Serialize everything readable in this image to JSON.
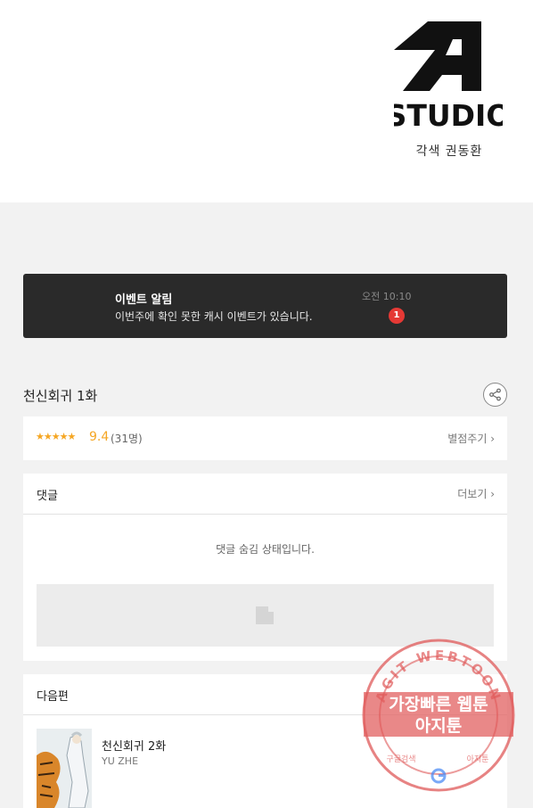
{
  "hero": {
    "logo_text": "STUDIO",
    "credit": "각색 권동환"
  },
  "banner": {
    "title": "이벤트 알림",
    "message": "이번주에 확인 못한 캐시 이벤트가 있습니다.",
    "time": "오전 10:10",
    "badge_count": "1"
  },
  "episode": {
    "title": "천신회귀 1화",
    "share_icon": "share-icon"
  },
  "rating": {
    "stars": "★★★★★",
    "stars_value": 4.5,
    "score": "9.4",
    "count": "(31명)",
    "rate_link": "별점주기 ›"
  },
  "comments": {
    "title": "댓글",
    "more_link": "더보기 ›",
    "hidden_message": "댓글 숨김 상태입니다."
  },
  "next": {
    "title": "다음편",
    "episode_title": "천신회귀 2화",
    "author": "YU ZHE"
  },
  "watermark": {
    "ring_text": "AGIT WEBTOON",
    "line1": "가장빠른 웹툰",
    "line2": "아지툰",
    "footer_left": "구글검색",
    "footer_right": "아지툰"
  },
  "colors": {
    "banner_bg": "#2a2a2a",
    "star": "#f5a623",
    "badge": "#e53935",
    "stamp": "#e05a5a"
  }
}
